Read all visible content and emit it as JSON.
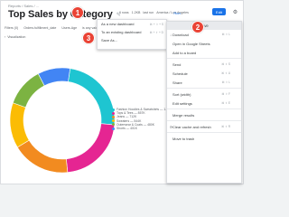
{
  "header": {
    "breadcrumb": "Reports / Sales / ...",
    "title": "Top Sales by Category",
    "meta": [
      "6 rows",
      "1.2KB",
      "last run",
      "America / Los Angeles"
    ],
    "run_label": "Run",
    "edit_label": "Edit"
  },
  "filters": [
    "Filters (0)",
    "Orders.fulfillment_date",
    "Users.Age",
    "is any value"
  ],
  "visualization_label": "Visualization",
  "chart_data": {
    "type": "pie",
    "donut": true,
    "categories": [
      "Fashion Hoodies & Sweatshirts",
      "Tops & Tees",
      "Jeans",
      "Sweaters",
      "Outerwear & Coats",
      "Shorts"
    ],
    "values": [
      24,
      22,
      18,
      14,
      12,
      10
    ],
    "colors": [
      "#1ec5d1",
      "#e52592",
      "#f28b20",
      "#fbbc04",
      "#7cb342",
      "#4285f4"
    ],
    "legend_position": "right"
  },
  "legend": [
    {
      "label": "Fashion Hoodies & Sweatshirts",
      "value": "1.1M",
      "color": "#1ec5d1"
    },
    {
      "label": "Tops & Tees",
      "value": "857K",
      "color": "#e52592"
    },
    {
      "label": "Jeans",
      "value": "712K",
      "color": "#f28b20"
    },
    {
      "label": "Sweaters",
      "value": "544K",
      "color": "#fbbc04"
    },
    {
      "label": "Outerwear & Coats",
      "value": "480K",
      "color": "#7cb342"
    },
    {
      "label": "Shorts",
      "value": "401K",
      "color": "#4285f4"
    }
  ],
  "menu": {
    "header": "Save",
    "items": [
      {
        "label": "Download",
        "shortcut": "⌘ ⇧ L"
      },
      {
        "label": "Open in Google Sheets",
        "shortcut": ""
      },
      {
        "label": "Add to a board",
        "shortcut": ""
      },
      {
        "label": "Send",
        "shortcut": "⌘ ⇧ S"
      },
      {
        "label": "Schedule",
        "shortcut": "⌘ ⇧ U"
      },
      {
        "label": "Share",
        "shortcut": "⌘ ⇧ L"
      },
      {
        "label": "Sort (width)",
        "shortcut": "⌘ ⇧ F"
      },
      {
        "label": "Edit settings",
        "shortcut": "⌘ ⇧ E"
      },
      {
        "label": "Merge results",
        "shortcut": ""
      },
      {
        "label": "Clear cache and refresh",
        "shortcut": "⌘ ⇧ R"
      },
      {
        "label": "Move to trash",
        "shortcut": ""
      }
    ]
  },
  "submenu": {
    "items": [
      {
        "label": "As a new dashboard",
        "shortcut": "⌘ + ⇧ + S"
      },
      {
        "label": "To an existing dashboard",
        "shortcut": "⌘ + ⇧ + D"
      },
      {
        "label": "Save As...",
        "shortcut": ""
      }
    ]
  },
  "badges": [
    "1",
    "2",
    "3"
  ]
}
